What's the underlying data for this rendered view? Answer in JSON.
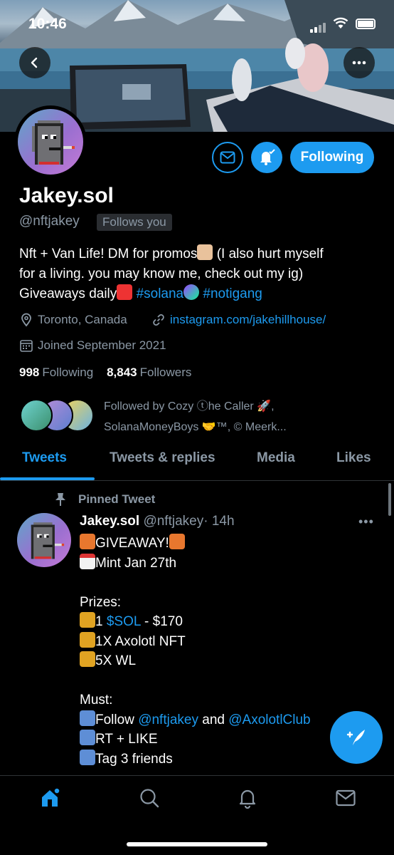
{
  "status_bar": {
    "time": "10:46"
  },
  "profile": {
    "name": "Jakey.sol",
    "handle": "@nftjakey",
    "follows_you_label": "Follows you",
    "follow_button_label": "Following",
    "bio": {
      "line1": "Nft + Van Life! DM for promos",
      "line1b": " (I also hurt myself",
      "line2": "for a living. you may know me, check out my ig)",
      "line3a": "Giveaways daily",
      "hashtag1": "#solana",
      "hashtag2": "#notigang"
    },
    "location": "Toronto, Canada",
    "website": "instagram.com/jakehillhouse/",
    "joined": "Joined September 2021",
    "following_count": "998",
    "following_label": "Following",
    "followers_count": "8,843",
    "followers_label": "Followers",
    "followed_by_line1": "Followed by Cozy ⓣhe Caller 🚀,",
    "followed_by_line2": "SolanaMoneyBoys 🤝™, © Meerk..."
  },
  "tabs": [
    {
      "label": "Tweets",
      "active": true
    },
    {
      "label": "Tweets & replies",
      "active": false
    },
    {
      "label": "Media",
      "active": false
    },
    {
      "label": "Likes",
      "active": false
    }
  ],
  "pinned_tweet": {
    "pinned_label": "Pinned Tweet",
    "author_name": "Jakey.sol",
    "author_handle": "@nftjakey",
    "time": "· 14h",
    "lines": {
      "l1": "GIVEAWAY!",
      "l2": "Mint Jan 27th",
      "l3": "Prizes:",
      "l4a": "1 ",
      "l4_cashtag": "$SOL",
      "l4b": " - $170",
      "l5": "1X Axolotl NFT",
      "l6": "5X WL",
      "l7": "Must:",
      "l8a": "Follow ",
      "l8_mention1": "@nftjakey",
      "l8b": " and ",
      "l8_mention2": "@AxolotlClub",
      "l9": "RT + LIKE",
      "l10": "Tag 3 friends"
    }
  },
  "colors": {
    "accent": "#1d9bf0",
    "muted": "#8b98a5",
    "background": "#000000"
  },
  "bottom_nav": [
    "home-icon",
    "search-icon",
    "notifications-icon",
    "messages-icon"
  ]
}
